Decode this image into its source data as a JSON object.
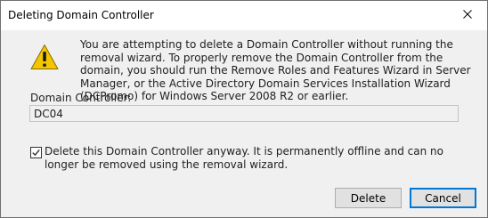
{
  "window": {
    "title": "Deleting Domain Controller"
  },
  "message": {
    "text": "You are attempting to delete a Domain Controller without running the removal wizard. To properly remove the Domain Controller from the domain, you should run the Remove Roles and Features Wizard in Server Manager, or the Active Directory Domain Services Installation Wizard (DCPromo) for Windows Server 2008 R2 or earlier."
  },
  "domain_controller": {
    "label": "Domain Controller:",
    "value": "DC04"
  },
  "confirm": {
    "checked": true,
    "label": "Delete this Domain Controller anyway. It is permanently offline and can no longer be removed using the removal wizard."
  },
  "buttons": {
    "delete": "Delete",
    "cancel": "Cancel"
  },
  "icons": {
    "warning": "warning-icon",
    "close": "close-icon",
    "check": "checkmark-icon"
  },
  "colors": {
    "dialog_background": "#f0f0f0",
    "title_background": "#ffffff",
    "warning_yellow": "#f3c600",
    "focus_border": "#0078d7"
  }
}
